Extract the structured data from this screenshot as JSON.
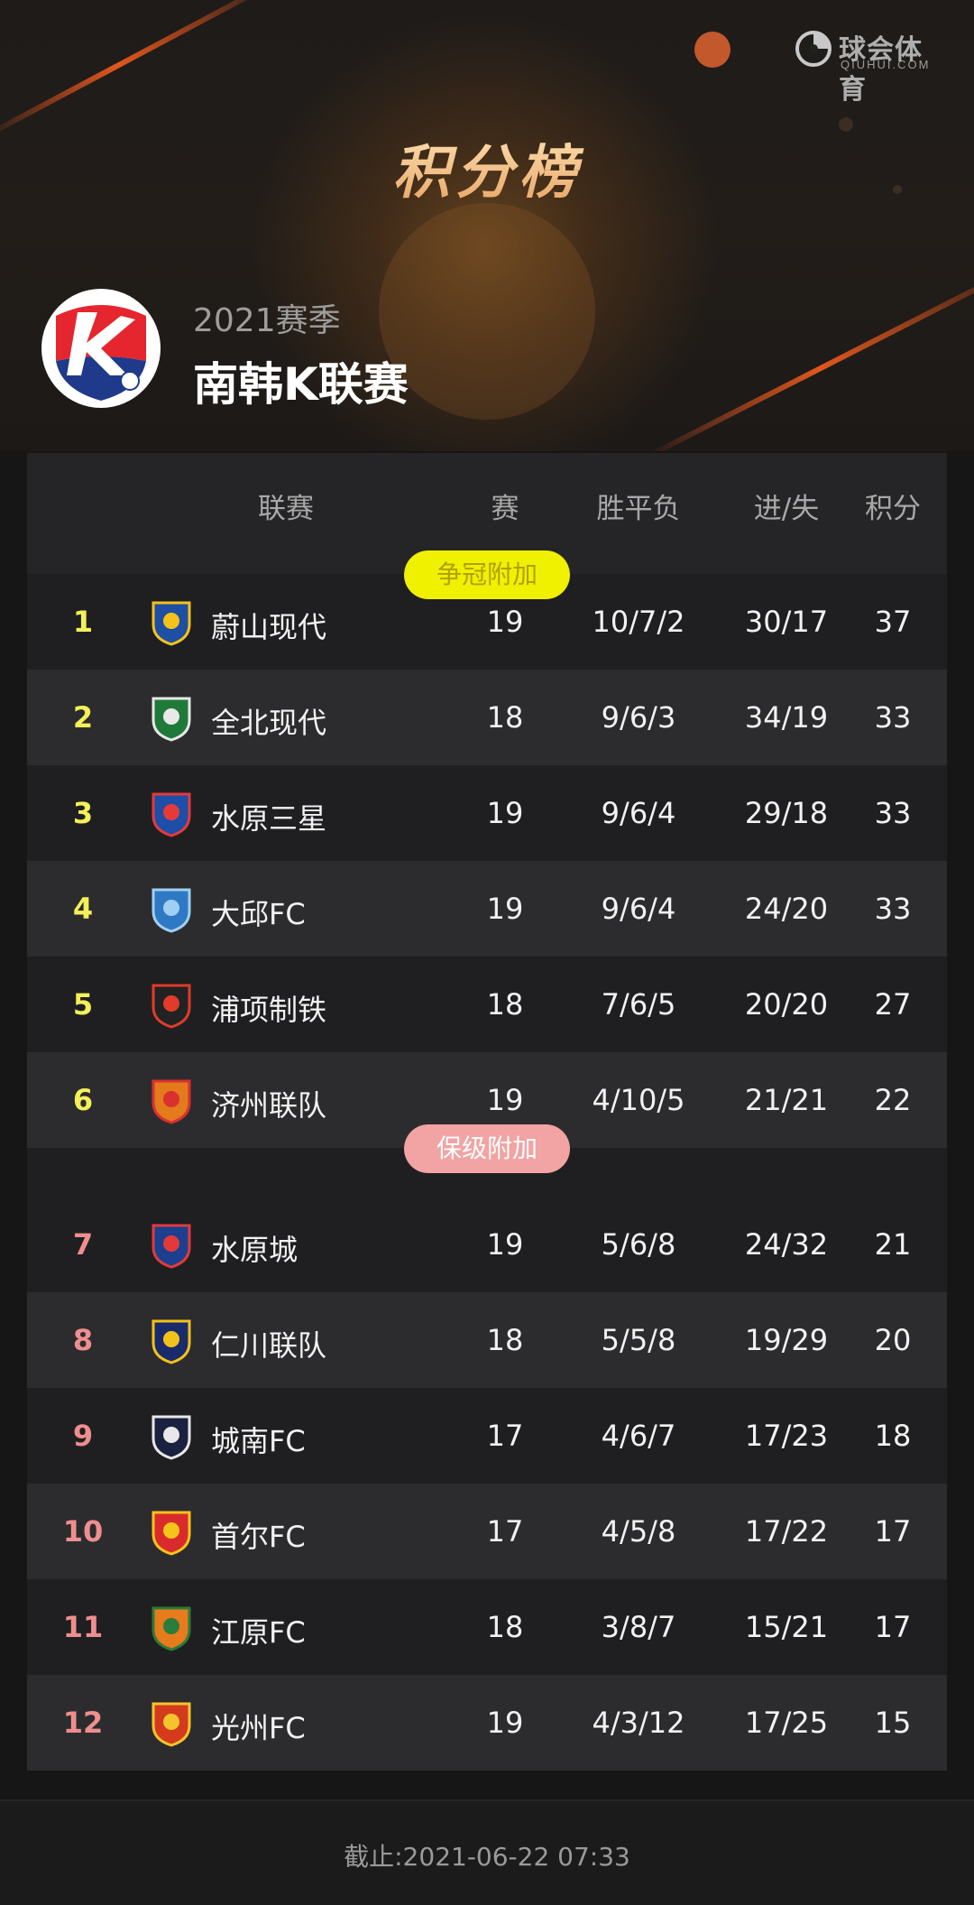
{
  "watermark": {
    "name": "球会体育",
    "domain": "QIUHUI.COM"
  },
  "header": {
    "title": "积分榜",
    "season": "2021赛季",
    "league": "南韩K联赛"
  },
  "columns": {
    "league": "联赛",
    "games": "赛",
    "wdl": "胜平负",
    "goals": "进/失",
    "points": "积分"
  },
  "zones": {
    "champion": "争冠附加",
    "relegation": "保级附加"
  },
  "teams": [
    {
      "rank": "1",
      "name": "蔚山现代",
      "games": "19",
      "wdl": "10/7/2",
      "goals": "30/17",
      "points": "37"
    },
    {
      "rank": "2",
      "name": "全北现代",
      "games": "18",
      "wdl": "9/6/3",
      "goals": "34/19",
      "points": "33"
    },
    {
      "rank": "3",
      "name": "水原三星",
      "games": "19",
      "wdl": "9/6/4",
      "goals": "29/18",
      "points": "33"
    },
    {
      "rank": "4",
      "name": "大邱FC",
      "games": "19",
      "wdl": "9/6/4",
      "goals": "24/20",
      "points": "33"
    },
    {
      "rank": "5",
      "name": "浦项制铁",
      "games": "18",
      "wdl": "7/6/5",
      "goals": "20/20",
      "points": "27"
    },
    {
      "rank": "6",
      "name": "济州联队",
      "games": "19",
      "wdl": "4/10/5",
      "goals": "21/21",
      "points": "22"
    },
    {
      "rank": "7",
      "name": "水原城",
      "games": "19",
      "wdl": "5/6/8",
      "goals": "24/32",
      "points": "21"
    },
    {
      "rank": "8",
      "name": "仁川联队",
      "games": "18",
      "wdl": "5/5/8",
      "goals": "19/29",
      "points": "20"
    },
    {
      "rank": "9",
      "name": "城南FC",
      "games": "17",
      "wdl": "4/6/7",
      "goals": "17/23",
      "points": "18"
    },
    {
      "rank": "10",
      "name": "首尔FC",
      "games": "17",
      "wdl": "4/5/8",
      "goals": "17/22",
      "points": "17"
    },
    {
      "rank": "11",
      "name": "江原FC",
      "games": "18",
      "wdl": "3/8/7",
      "goals": "15/21",
      "points": "17"
    },
    {
      "rank": "12",
      "name": "光州FC",
      "games": "19",
      "wdl": "4/3/12",
      "goals": "17/25",
      "points": "15"
    }
  ],
  "footer": {
    "updated": "截止:2021-06-22 07:33"
  }
}
